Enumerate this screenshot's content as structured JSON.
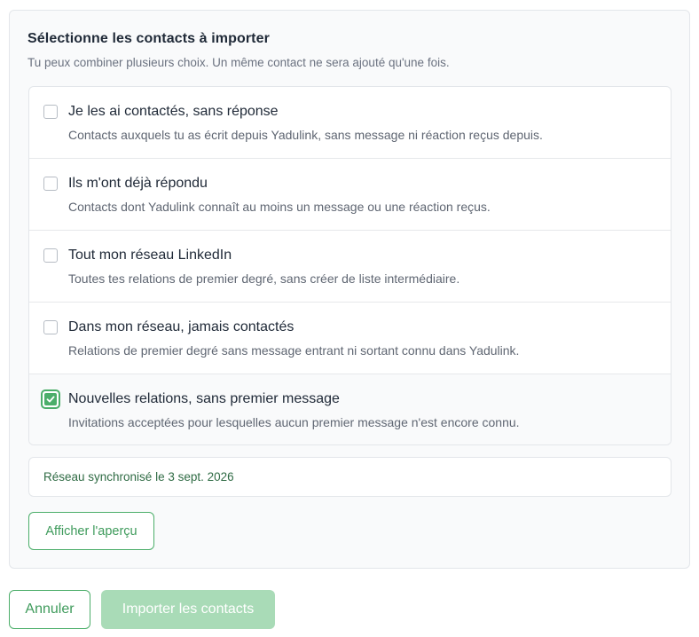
{
  "panel": {
    "title": "Sélectionne les contacts à importer",
    "subtitle": "Tu peux combiner plusieurs choix. Un même contact ne sera ajouté qu'une fois."
  },
  "options": [
    {
      "label": "Je les ai contactés, sans réponse",
      "description": "Contacts auxquels tu as écrit depuis Yadulink, sans message ni réaction reçus depuis.",
      "checked": false
    },
    {
      "label": "Ils m'ont déjà répondu",
      "description": "Contacts dont Yadulink connaît au moins un message ou une réaction reçus.",
      "checked": false
    },
    {
      "label": "Tout mon réseau LinkedIn",
      "description": "Toutes tes relations de premier degré, sans créer de liste intermédiaire.",
      "checked": false
    },
    {
      "label": "Dans mon réseau, jamais contactés",
      "description": "Relations de premier degré sans message entrant ni sortant connu dans Yadulink.",
      "checked": false
    },
    {
      "label": "Nouvelles relations, sans premier message",
      "description": "Invitations acceptées pour lesquelles aucun premier message n'est encore connu.",
      "checked": true
    }
  ],
  "sync": {
    "text": "Réseau synchronisé le 3 sept. 2026"
  },
  "buttons": {
    "preview_label": "Afficher l'aperçu",
    "cancel_label": "Annuler",
    "import_label": "Importer les contacts"
  },
  "colors": {
    "accent": "#4cae6a",
    "accent_text": "#3f9b5c",
    "import_disabled": "#a9dbb7",
    "sync_text": "#2f6b44"
  }
}
